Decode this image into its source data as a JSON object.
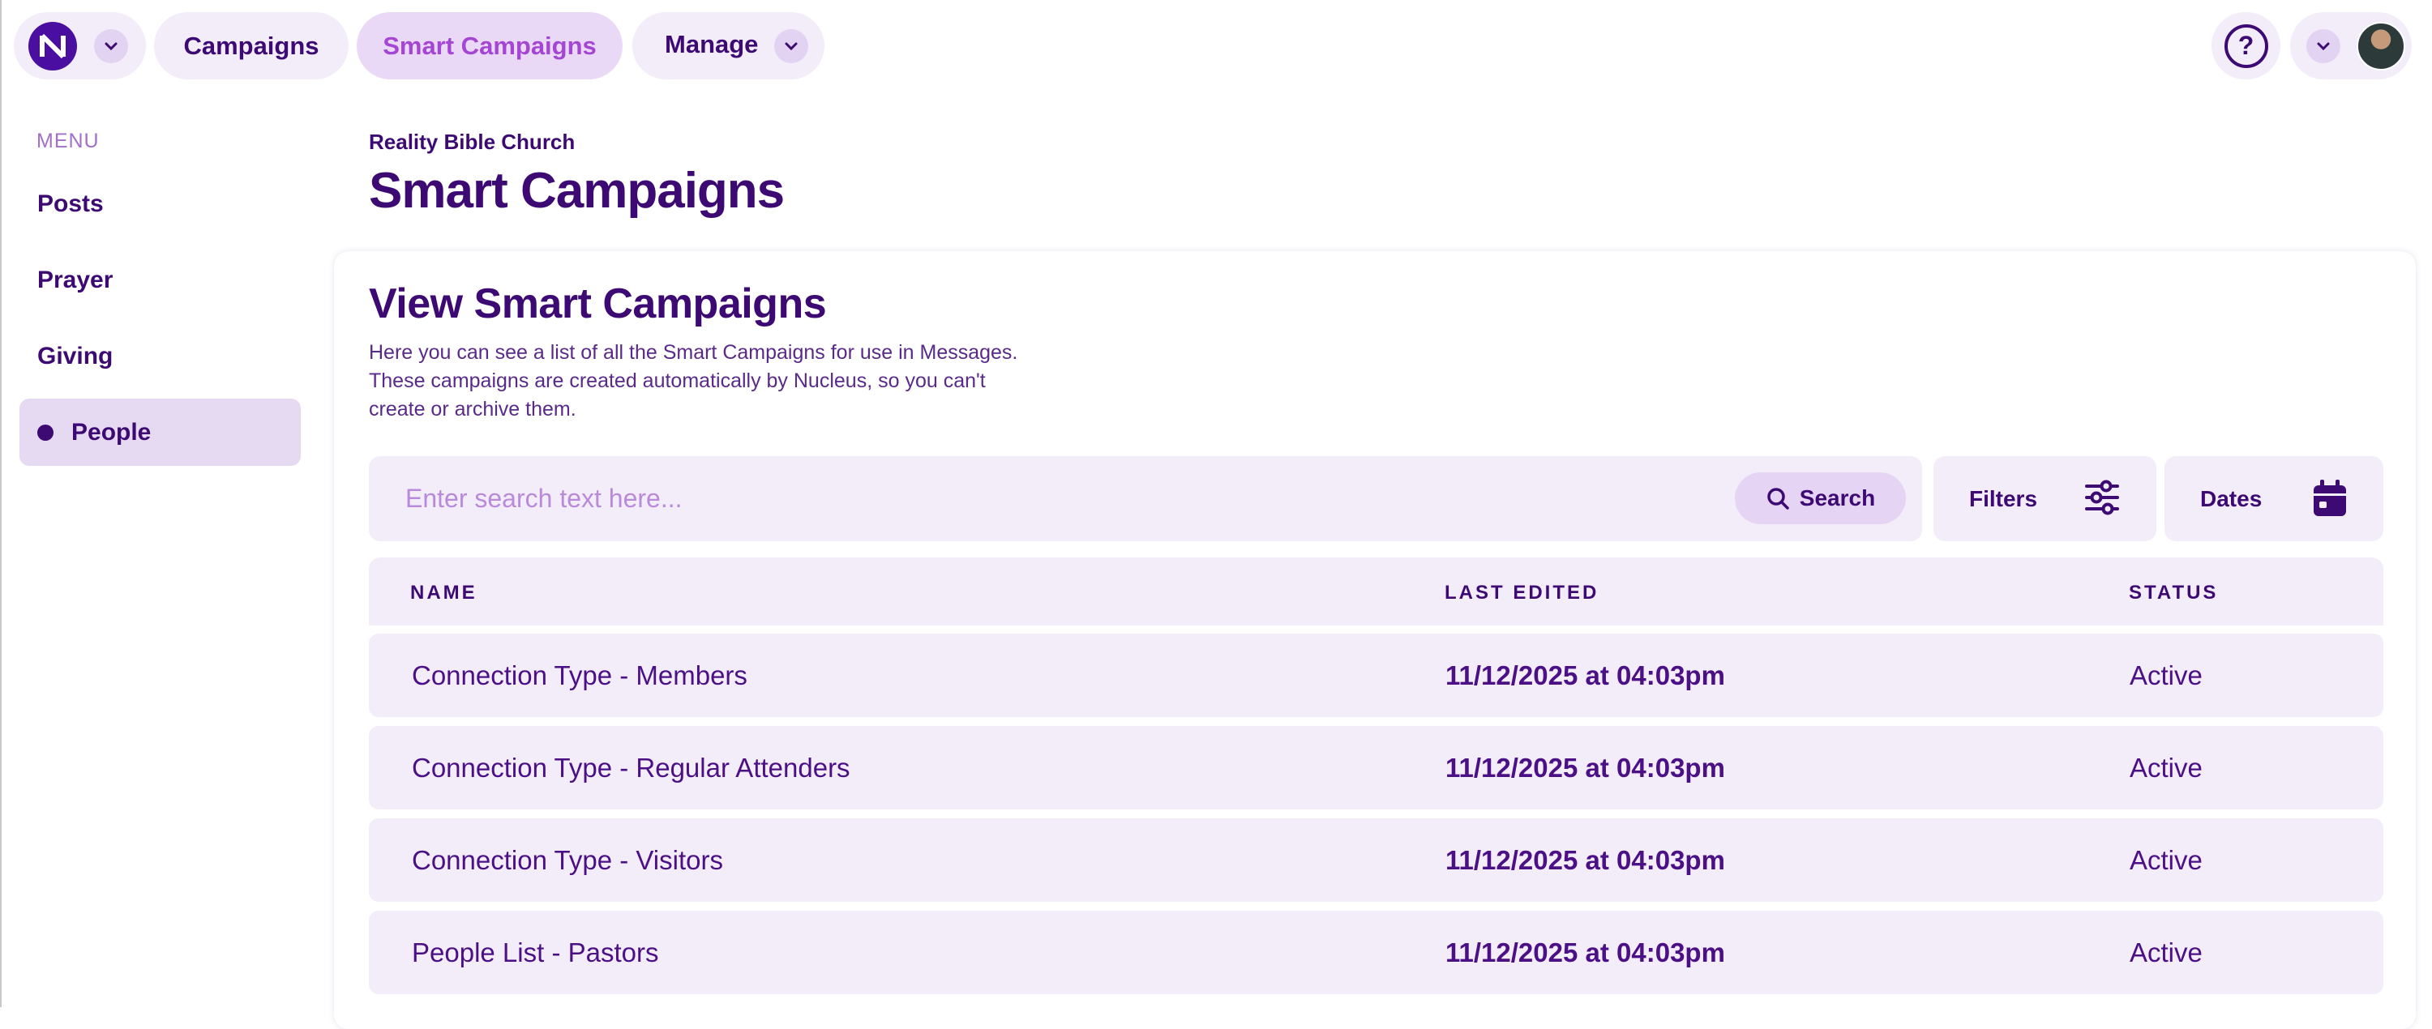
{
  "topnav": {
    "items": [
      {
        "label": "Campaigns"
      },
      {
        "label": "Smart Campaigns"
      },
      {
        "label": "Manage"
      }
    ],
    "help_symbol": "?"
  },
  "sidebar": {
    "menu_label": "MENU",
    "items": [
      {
        "label": "Posts"
      },
      {
        "label": "Prayer"
      },
      {
        "label": "Giving"
      },
      {
        "label": "People"
      }
    ]
  },
  "header": {
    "org_name": "Reality Bible Church",
    "title": "Smart Campaigns"
  },
  "card": {
    "title": "View Smart Campaigns",
    "description_lines": [
      "Here you can see a list of all the Smart Campaigns for use in Messages.",
      "These campaigns are created automatically by Nucleus, so you can't",
      "create or archive them."
    ],
    "search": {
      "placeholder": "Enter search text here...",
      "button_label": "Search"
    },
    "filters_label": "Filters",
    "dates_label": "Dates"
  },
  "table": {
    "columns": [
      "NAME",
      "LAST EDITED",
      "STATUS"
    ],
    "rows": [
      {
        "name": "Connection Type - Members",
        "last_edited": "11/12/2025 at 04:03pm",
        "status": "Active"
      },
      {
        "name": "Connection Type - Regular Attenders",
        "last_edited": "11/12/2025 at 04:03pm",
        "status": "Active"
      },
      {
        "name": "Connection Type - Visitors",
        "last_edited": "11/12/2025 at 04:03pm",
        "status": "Active"
      },
      {
        "name": "People List - Pastors",
        "last_edited": "11/12/2025 at 04:03pm",
        "status": "Active"
      }
    ]
  },
  "colors": {
    "primary": "#3d0a73",
    "accent": "#a445d4",
    "surface": "#f3edfa",
    "active_bg": "#e6daf3"
  }
}
